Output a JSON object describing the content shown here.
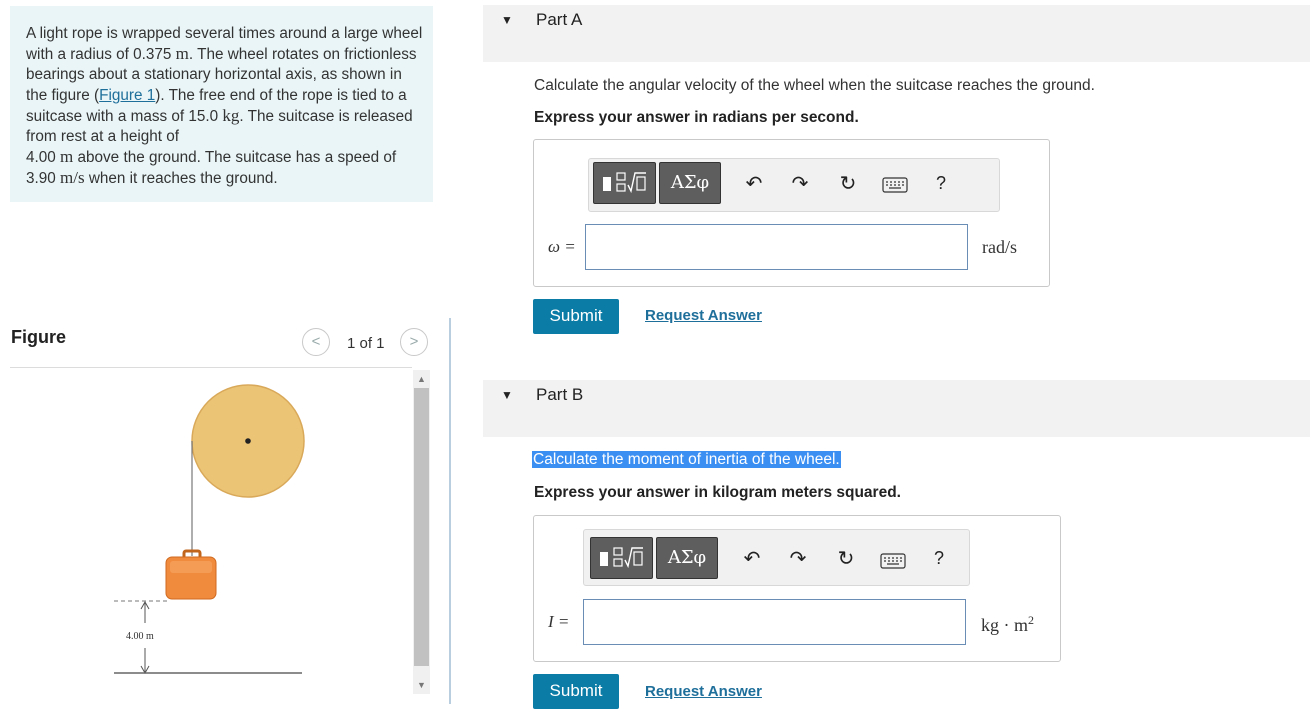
{
  "problem": {
    "text_1": "A light rope is wrapped several times around a large wheel with a radius of 0.375 ",
    "unit_m_1": "m",
    "text_2": ". The wheel rotates on frictionless bearings about a stationary horizontal axis, as shown in the figure (",
    "figure_link": "Figure 1",
    "text_3": "). The free end of the rope is tied to a suitcase with a mass of 15.0 ",
    "unit_kg": "kg",
    "text_4": ". The suitcase is released from rest at a height of ",
    "height_value": "4.00 ",
    "unit_m_2": "m",
    "text_5": " above the ground. The suitcase has a speed of 3.90 ",
    "unit_speed": "m/s",
    "text_6": " when it reaches the ground."
  },
  "figure_panel": {
    "title": "Figure",
    "prev_glyph": "<",
    "next_glyph": ">",
    "count": "1 of 1",
    "height_label": "4.00 m",
    "colors": {
      "wheel": "#ecc475",
      "wheel_edge": "#d9a95a",
      "suitcase": "#f08a3c"
    }
  },
  "parts": [
    {
      "caret": "▼",
      "title": "Part A",
      "question": "Calculate the angular velocity of the wheel when the suitcase reaches the ground.",
      "instruction": "Express your answer in radians per second.",
      "toolbar": {
        "greek_label": "ΑΣφ",
        "undo_glyph": "↶",
        "redo_glyph": "↷",
        "reset_glyph": "↻",
        "help_glyph": "?"
      },
      "variable": "ω =",
      "input_value": "",
      "unit": "rad/s",
      "submit_label": "Submit",
      "request_label": "Request Answer"
    },
    {
      "caret": "▼",
      "title": "Part B",
      "question": "Calculate the moment of inertia of the wheel.",
      "instruction": "Express your answer in kilogram meters squared.",
      "toolbar": {
        "greek_label": "ΑΣφ",
        "undo_glyph": "↶",
        "redo_glyph": "↷",
        "reset_glyph": "↻",
        "help_glyph": "?"
      },
      "variable": "I =",
      "input_value": "",
      "unit": "kg · m",
      "unit_exponent": "2",
      "submit_label": "Submit",
      "request_label": "Request Answer"
    }
  ],
  "colors": {
    "problem_bg": "#e9f5f7",
    "submit_bg": "#0b7ca6",
    "link": "#1f6f9b",
    "highlight": "#3c8ff2"
  }
}
